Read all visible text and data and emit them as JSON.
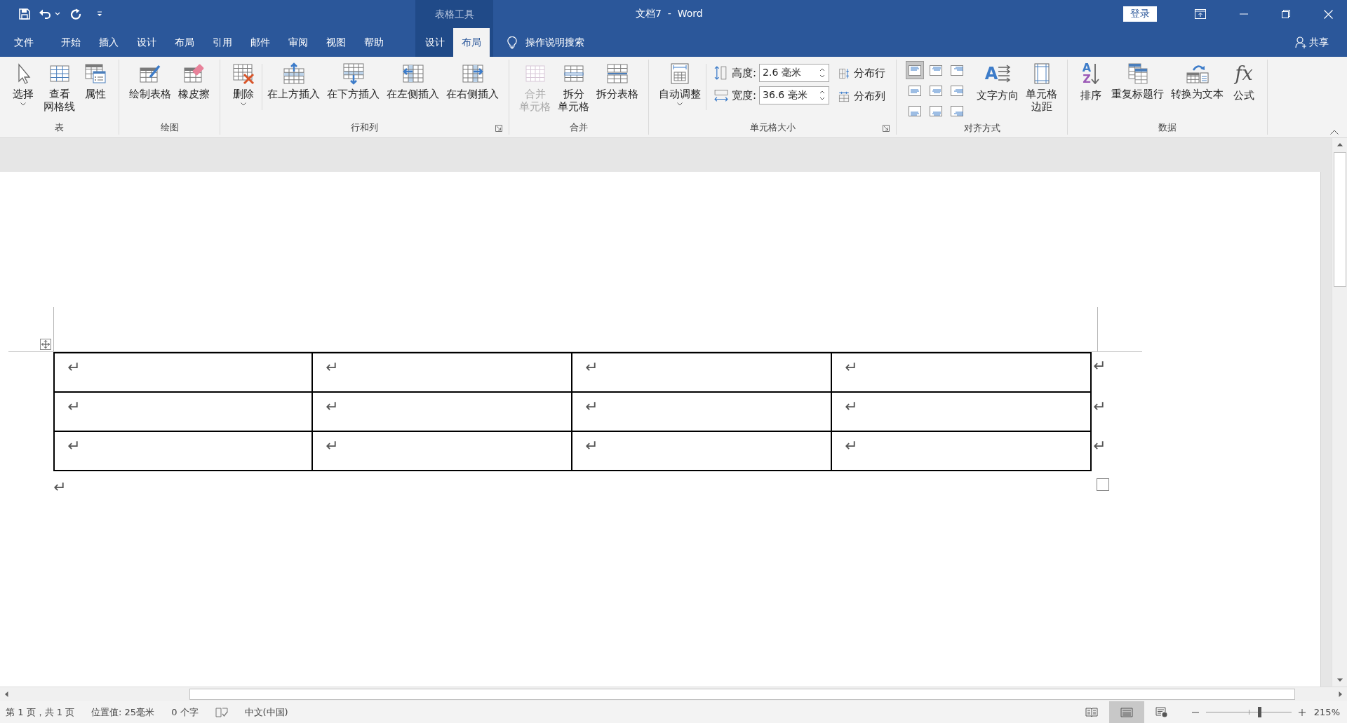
{
  "window": {
    "title": "文档7  -  Word",
    "context_group": "表格工具",
    "sign_in": "登录"
  },
  "tabs": [
    {
      "label": "文件",
      "selected": false,
      "kind": "normal"
    },
    {
      "label": "开始",
      "selected": false,
      "kind": "normal"
    },
    {
      "label": "插入",
      "selected": false,
      "kind": "normal"
    },
    {
      "label": "设计",
      "selected": false,
      "kind": "normal"
    },
    {
      "label": "布局",
      "selected": false,
      "kind": "normal"
    },
    {
      "label": "引用",
      "selected": false,
      "kind": "normal"
    },
    {
      "label": "邮件",
      "selected": false,
      "kind": "normal"
    },
    {
      "label": "审阅",
      "selected": false,
      "kind": "normal"
    },
    {
      "label": "视图",
      "selected": false,
      "kind": "normal"
    },
    {
      "label": "帮助",
      "selected": false,
      "kind": "normal"
    },
    {
      "label": "设计",
      "selected": false,
      "kind": "context"
    },
    {
      "label": "布局",
      "selected": true,
      "kind": "context"
    }
  ],
  "tell_me": "操作说明搜索",
  "share": "共享",
  "ribbon": [
    {
      "name": "表",
      "launcher": false,
      "items": [
        {
          "kind": "large",
          "label": [
            "选择"
          ],
          "dropdown": true,
          "disabled": false
        },
        {
          "kind": "large",
          "label": [
            "查看",
            "网格线"
          ],
          "dropdown": false,
          "disabled": false
        },
        {
          "kind": "large",
          "label": [
            "属性"
          ],
          "dropdown": false,
          "disabled": false
        }
      ]
    },
    {
      "name": "绘图",
      "launcher": false,
      "items": [
        {
          "kind": "large",
          "label": [
            "绘制表格"
          ],
          "dropdown": false,
          "disabled": false
        },
        {
          "kind": "large",
          "label": [
            "橡皮擦"
          ],
          "dropdown": false,
          "disabled": false
        }
      ]
    },
    {
      "name": "行和列",
      "launcher": true,
      "items": [
        {
          "kind": "large",
          "label": [
            "删除"
          ],
          "dropdown": true,
          "disabled": false
        },
        {
          "kind": "divider"
        },
        {
          "kind": "large",
          "label": [
            "在上方插入"
          ],
          "dropdown": false,
          "disabled": false
        },
        {
          "kind": "large",
          "label": [
            "在下方插入"
          ],
          "dropdown": false,
          "disabled": false
        },
        {
          "kind": "large",
          "label": [
            "在左侧插入"
          ],
          "dropdown": false,
          "disabled": false
        },
        {
          "kind": "large",
          "label": [
            "在右侧插入"
          ],
          "dropdown": false,
          "disabled": false
        }
      ]
    },
    {
      "name": "合并",
      "launcher": false,
      "items": [
        {
          "kind": "large",
          "label": [
            "合并",
            "单元格"
          ],
          "dropdown": false,
          "disabled": true
        },
        {
          "kind": "large",
          "label": [
            "拆分",
            "单元格"
          ],
          "dropdown": false,
          "disabled": false
        },
        {
          "kind": "large",
          "label": [
            "拆分表格"
          ],
          "dropdown": false,
          "disabled": false
        }
      ]
    },
    {
      "name": "单元格大小",
      "launcher": true,
      "items": [
        {
          "kind": "large",
          "label": [
            "自动调整"
          ],
          "dropdown": true,
          "disabled": false
        },
        {
          "kind": "divider"
        },
        {
          "kind": "fields",
          "fields": [
            {
              "label": "高度:",
              "value": "2.6 毫米"
            },
            {
              "label": "宽度:",
              "value": "36.6 毫米"
            }
          ]
        },
        {
          "kind": "stack",
          "buttons": [
            {
              "label": "分布行"
            },
            {
              "label": "分布列"
            }
          ]
        }
      ]
    },
    {
      "name": "对齐方式",
      "launcher": false,
      "items": [
        {
          "kind": "align_grid",
          "buttons": [
            {
              "selected": true
            },
            {
              "selected": false
            },
            {
              "selected": false
            },
            {
              "selected": false
            },
            {
              "selected": false
            },
            {
              "selected": false
            },
            {
              "selected": false
            },
            {
              "selected": false
            },
            {
              "selected": false
            }
          ]
        },
        {
          "kind": "large",
          "glyphs": [
            "A"
          ],
          "label": [
            "文字方向"
          ],
          "dropdown": false,
          "disabled": false
        },
        {
          "kind": "large",
          "label": [
            "单元格",
            "边距"
          ],
          "dropdown": false,
          "disabled": false
        }
      ]
    },
    {
      "name": "数据",
      "launcher": false,
      "items": [
        {
          "kind": "large",
          "glyphs": [
            "A",
            "Z"
          ],
          "label": [
            "排序"
          ],
          "dropdown": false,
          "disabled": false
        },
        {
          "kind": "large",
          "label": [
            "重复标题行"
          ],
          "dropdown": false,
          "disabled": false
        },
        {
          "kind": "large",
          "label": [
            "转换为文本"
          ],
          "dropdown": false,
          "disabled": false
        },
        {
          "kind": "large",
          "glyphs": [
            "fx"
          ],
          "label": [
            "公式"
          ],
          "dropdown": false,
          "disabled": false
        }
      ]
    }
  ],
  "table": {
    "rows": [
      {
        "cells": [
          "↵",
          "↵",
          "↵",
          "↵"
        ],
        "end_mark": "↵"
      },
      {
        "cells": [
          "↵",
          "↵",
          "↵",
          "↵"
        ],
        "end_mark": "↵"
      },
      {
        "cells": [
          "↵",
          "↵",
          "↵",
          "↵"
        ],
        "end_mark": "↵"
      }
    ]
  },
  "after_table_mark": "↵",
  "status_bar": {
    "items": [
      {
        "kind": "text",
        "text": "第 1 页，共 1 页"
      },
      {
        "kind": "text",
        "text": "位置值: 25毫米"
      },
      {
        "kind": "text",
        "text": "0 个字"
      },
      {
        "kind": "proofing"
      },
      {
        "kind": "text",
        "text": "中文(中国)"
      }
    ],
    "views": [
      {
        "kind": "read",
        "selected": false
      },
      {
        "kind": "print",
        "selected": true
      },
      {
        "kind": "web",
        "selected": false
      }
    ],
    "zoom": {
      "level": 0.63,
      "text": "215%"
    }
  }
}
